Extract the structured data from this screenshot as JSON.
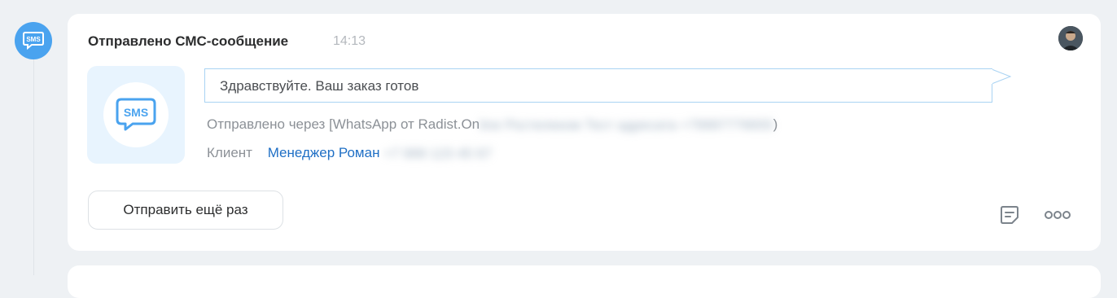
{
  "event": {
    "title": "Отправлено СМС-сообщение",
    "time": "14:13",
    "message": "Здравствуйте. Ваш заказ готов",
    "sent_via_prefix": "Отправлено через [WhatsApp от Radist.On",
    "sent_via_blurred": "line Ростелеком Тест адресата +79997776655",
    "sent_via_suffix": ")",
    "client_label": "Клиент",
    "client_name": "Менеджер Роман",
    "client_blurred": "+7 999 123 45 67",
    "resend_label": "Отправить ещё раз",
    "sms_badge_text": "SMS"
  },
  "icons": {
    "timeline": "sms-icon",
    "tile": "sms-icon",
    "note": "note-icon",
    "more": "more-horizontal-icon"
  },
  "colors": {
    "accent": "#4aa3ef",
    "link": "#1f6fc5",
    "bubble_border": "#a9d3f3",
    "tile_bg": "#e8f4fe"
  }
}
